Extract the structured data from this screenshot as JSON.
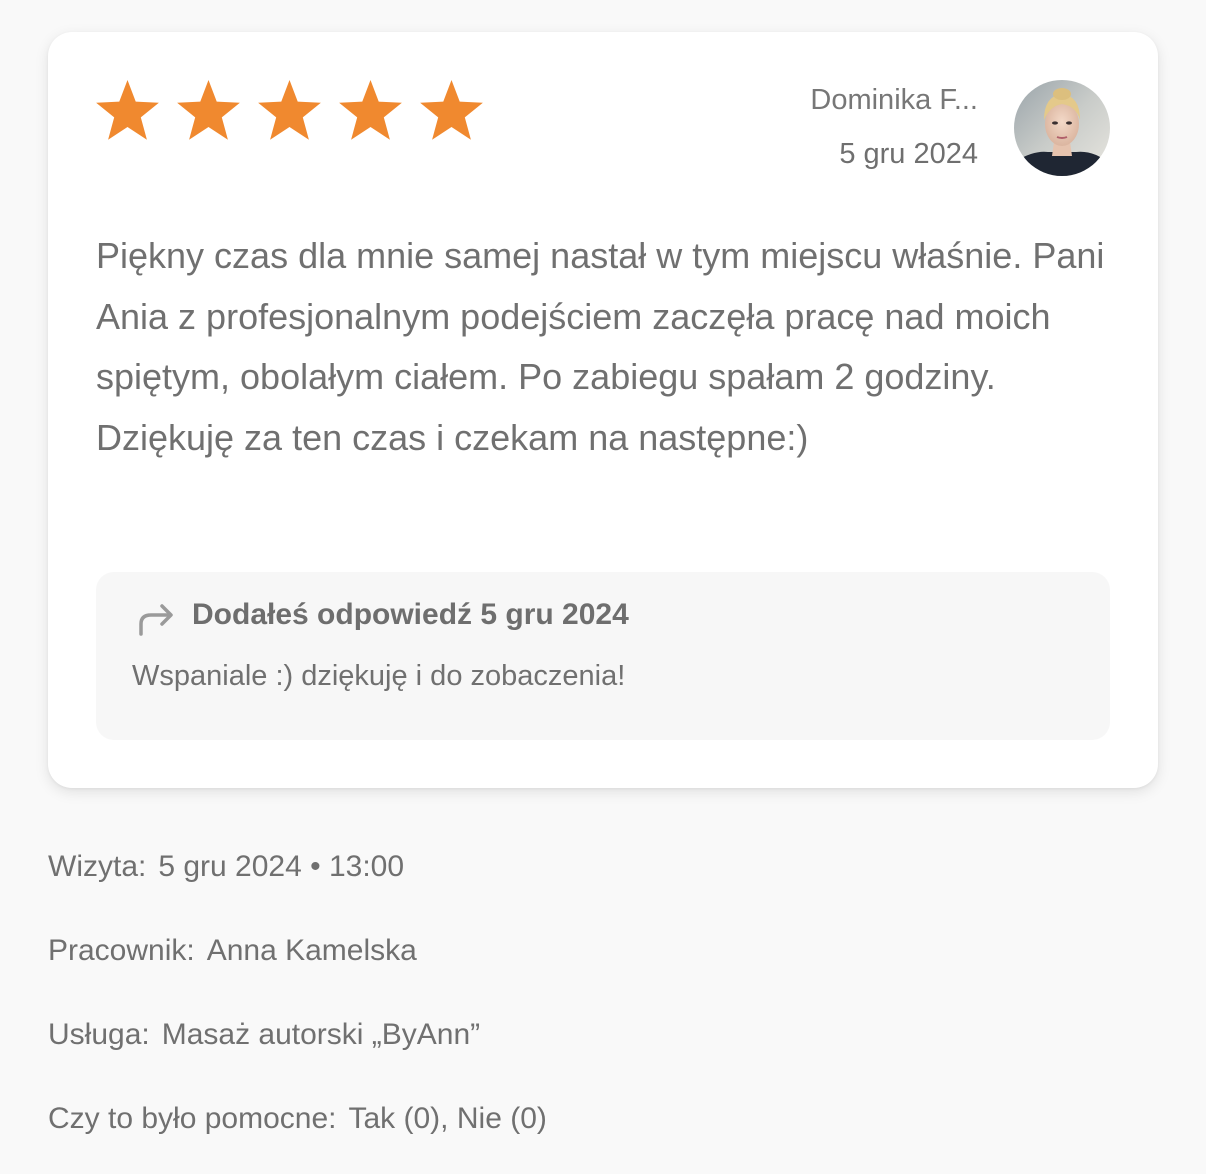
{
  "review": {
    "rating": 5,
    "rating_max": 5,
    "star_color": "#F0892F",
    "author_name": "Dominika F...",
    "date": "5 gru 2024",
    "text": "Piękny czas dla mnie samej nastał w tym miejscu właśnie. Pani Ania z profesjonalnym podejściem zaczęła pracę nad moich spiętym, obolałym ciałem. Po zabiegu spałam 2 godziny. Dziękuję za ten czas i czekam na następne:)"
  },
  "reply": {
    "header": "Dodałeś odpowiedź 5 gru 2024",
    "text": "Wspaniale :) dziękuję i do zobaczenia!"
  },
  "details": {
    "visit_label": "Wizyta:",
    "visit_value": "5 gru 2024 • 13:00",
    "employee_label": "Pracownik:",
    "employee_value": "Anna Kamelska",
    "service_label": "Usługa:",
    "service_value": "Masaż autorski „ByAnn”",
    "helpful_label": "Czy to było pomocne:",
    "helpful_yes": "Tak (0)",
    "helpful_sep": ",",
    "helpful_no": "Nie (0)"
  }
}
